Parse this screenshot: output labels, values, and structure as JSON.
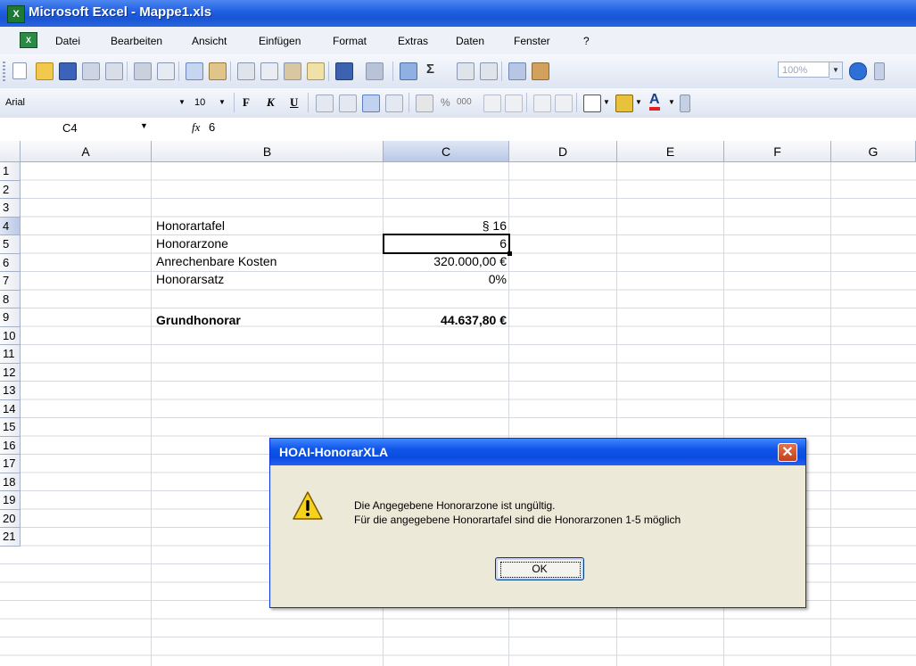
{
  "window": {
    "title": "Microsoft Excel - Mappe1.xls",
    "app_icon_glyph": "X"
  },
  "menu": [
    {
      "label": "Datei"
    },
    {
      "label": "Bearbeiten"
    },
    {
      "label": "Ansicht"
    },
    {
      "label": "Einfügen"
    },
    {
      "label": "Format"
    },
    {
      "label": "Extras"
    },
    {
      "label": "Daten"
    },
    {
      "label": "Fenster"
    },
    {
      "label": "?"
    }
  ],
  "toolbar": {
    "zoom": "100%",
    "font_name": "Arial",
    "font_size": "10",
    "bold_label": "F",
    "italic_label": "K",
    "underline_label": "U",
    "percent_label": "%",
    "thousands_label": "000",
    "sum_label": "Σ"
  },
  "formula_bar": {
    "name_box": "C4",
    "fx": "fx",
    "value": "6"
  },
  "columns": [
    "A",
    "B",
    "C",
    "D",
    "E",
    "F",
    "G"
  ],
  "rows": [
    "1",
    "2",
    "3",
    "4",
    "5",
    "6",
    "7",
    "8",
    "9",
    "10",
    "11",
    "12",
    "13",
    "14",
    "15",
    "16",
    "17",
    "18",
    "19",
    "20",
    "21"
  ],
  "cells": {
    "B3": "Honorartafel",
    "C3": "§ 16",
    "B4": "Honorarzone",
    "C4": "6",
    "B5": "Anrechenbare Kosten",
    "C5": "320.000,00 €",
    "B6": "Honorarsatz",
    "C6": "0%",
    "B8": "Grundhonorar",
    "C8": "44.637,80 €"
  },
  "dialog": {
    "title": "HOAI-HonorarXLA",
    "message_line1": "Die Angegebene Honorarzone ist ungültig.",
    "message_line2": "Für die angegebene Honorartafel sind die Honorarzonen 1-5 möglich",
    "ok_label": "OK",
    "close_glyph": "✕",
    "icon": "warning-icon"
  },
  "colors": {
    "titlebar": "#1e5ee0",
    "selection_header": "#b9c8e6",
    "dialog_bg": "#ece9d8"
  }
}
